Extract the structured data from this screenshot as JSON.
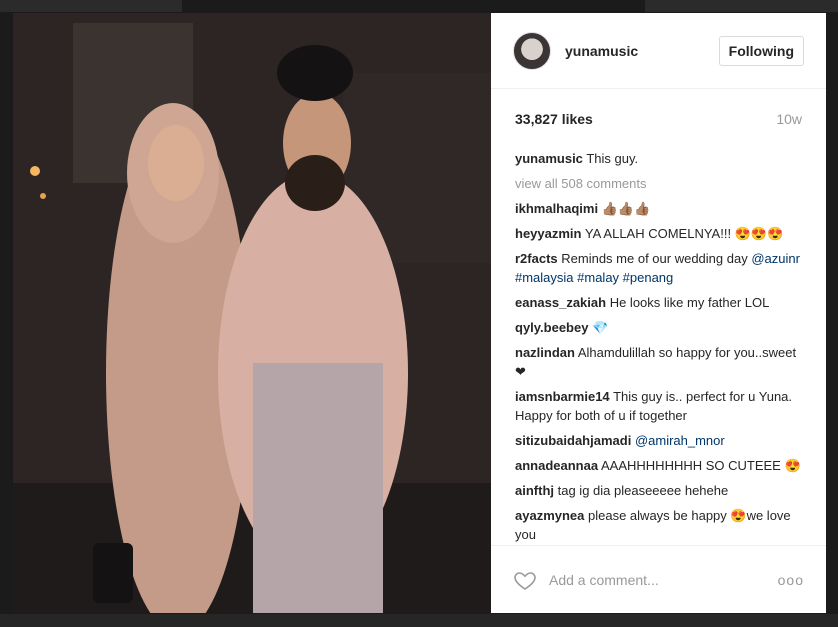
{
  "post": {
    "username": "yunamusic",
    "follow_label": "Following",
    "likes": "33,827 likes",
    "time_ago": "10w",
    "caption_user": "yunamusic",
    "caption_text": "This guy.",
    "view_all": "view all 508 comments",
    "add_comment_placeholder": "Add a comment...",
    "more_label": "ooo"
  },
  "comments": [
    {
      "user": "ikhmalhaqimi",
      "text": "👍🏽👍🏽👍🏽"
    },
    {
      "user": "heyyazmin",
      "text": "YA ALLAH COMELNYA!!! 😍😍😍"
    },
    {
      "user": "r2facts",
      "text": "Reminds me of our wedding day",
      "tags": "@azuinr #malaysia #malay #penang"
    },
    {
      "user": "eanass_zakiah",
      "text": "He looks like my father LOL"
    },
    {
      "user": "qyly.beebey",
      "text": "💎"
    },
    {
      "user": "nazlindan",
      "text": "Alhamdulillah so happy for you..sweet ❤"
    },
    {
      "user": "iamsnbarmie14",
      "text": "This guy is.. perfect for u Yuna. Happy for both of u if together"
    },
    {
      "user": "sitizubaidahjamadi",
      "text": "",
      "tags": "@amirah_mnor"
    },
    {
      "user": "annadeannaa",
      "text": "AAAHHHHHHHH SO CUTEEE 😍"
    },
    {
      "user": "ainfthj",
      "text": "tag ig dia pleaseeeee hehehe"
    },
    {
      "user": "ayazmynea",
      "text": "please always be happy 😍we love you"
    }
  ],
  "icons": {
    "heart": "heart-icon",
    "more": "more-options-icon"
  }
}
